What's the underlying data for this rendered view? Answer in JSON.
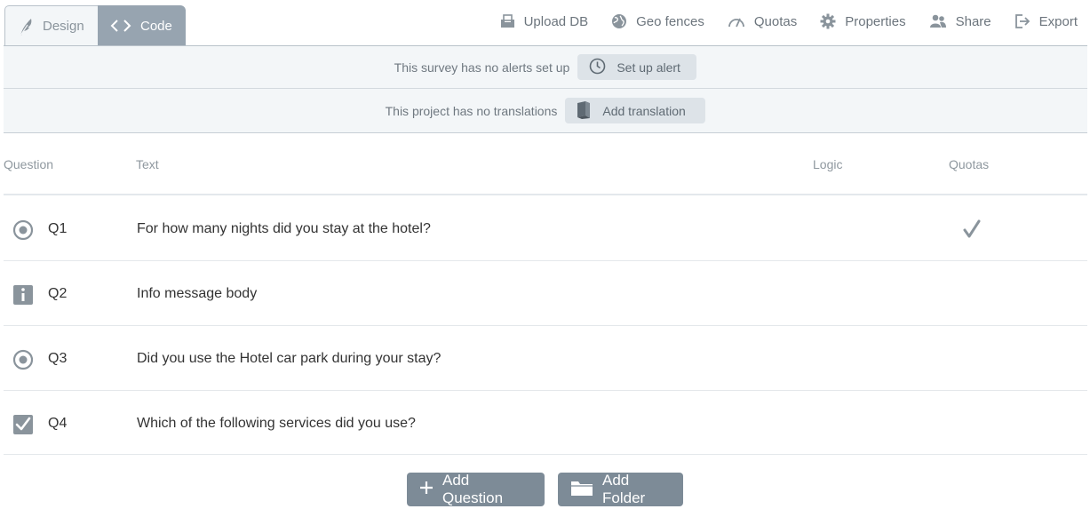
{
  "tabs": {
    "design": {
      "label": "Design",
      "icon": "feather-icon"
    },
    "code": {
      "label": "Code",
      "icon": "code-brackets-icon"
    }
  },
  "toolbar": [
    {
      "label": "Upload DB",
      "icon": "upload-db-icon"
    },
    {
      "label": "Geo fences",
      "icon": "globe-icon"
    },
    {
      "label": "Quotas",
      "icon": "gauge-icon"
    },
    {
      "label": "Properties",
      "icon": "gear-icon"
    },
    {
      "label": "Share",
      "icon": "users-icon"
    },
    {
      "label": "Export",
      "icon": "export-icon"
    }
  ],
  "alerts": {
    "message": "This survey has no alerts set up",
    "button": "Set up alert",
    "icon": "clock-icon"
  },
  "translations": {
    "message": "This project has no translations",
    "button": "Add translation",
    "icon": "book-icon"
  },
  "table": {
    "headers": {
      "question": "Question",
      "text": "Text",
      "logic": "Logic",
      "quotas": "Quotas"
    },
    "rows": [
      {
        "id": "Q1",
        "text": "For how many nights did you stay at the hotel?",
        "type_icon": "radio-icon",
        "quota": true
      },
      {
        "id": "Q2",
        "text": "Info message body",
        "type_icon": "info-icon",
        "quota": false
      },
      {
        "id": "Q3",
        "text": "Did you use the Hotel car park during your stay?",
        "type_icon": "radio-icon",
        "quota": false
      },
      {
        "id": "Q4",
        "text": "Which of the following services did you use?",
        "type_icon": "checkbox-icon",
        "quota": false
      }
    ]
  },
  "actions": {
    "add_question": "Add Question",
    "add_folder": "Add Folder"
  },
  "colors": {
    "accent_gray": "#7d8b97",
    "tab_active": "#97a4b0",
    "banner_bg": "#f3f6f8",
    "icon_gray": "#8a949c"
  }
}
